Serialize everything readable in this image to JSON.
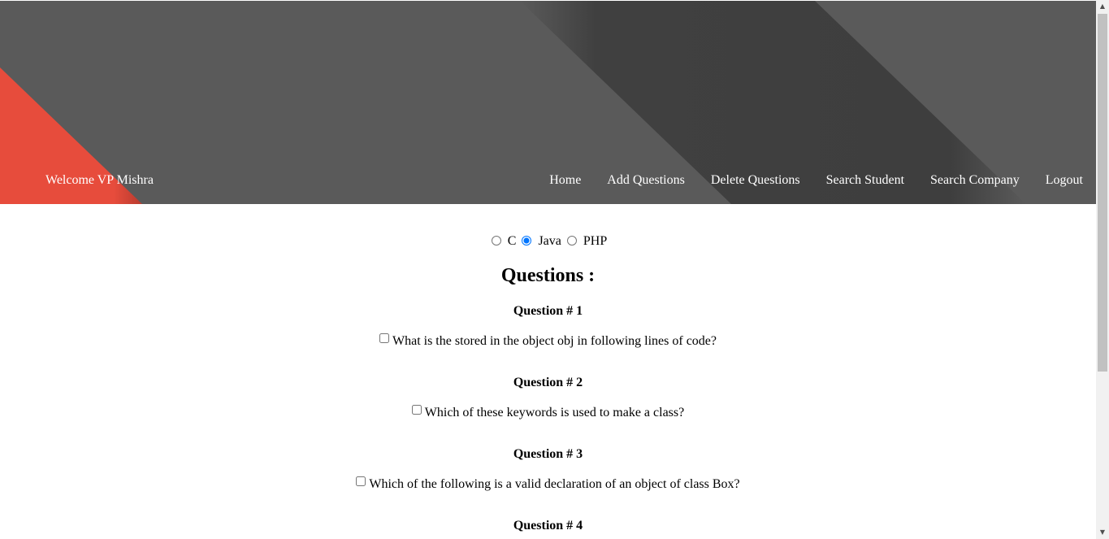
{
  "header": {
    "welcome": "Welcome VP Mishra",
    "nav": [
      "Home",
      "Add Questions",
      "Delete Questions",
      "Search Student",
      "Search Company",
      "Logout"
    ],
    "colors": {
      "banner": "#5a5a5a",
      "accent": "#e74c3c",
      "stripe": "#3f3f3f"
    }
  },
  "languages": {
    "options": [
      "C",
      "Java",
      "PHP"
    ],
    "selected": "Java"
  },
  "questions_title": "Questions :",
  "questions": [
    {
      "title": "Question # 1",
      "text": "What is the stored in the object obj in following lines of code?"
    },
    {
      "title": "Question # 2",
      "text": "Which of these keywords is used to make a class?"
    },
    {
      "title": "Question # 3",
      "text": "Which of the following is a valid declaration of an object of class Box?"
    },
    {
      "title": "Question # 4",
      "text": ""
    }
  ],
  "scrollbar": {
    "up_icon": "triangle-up",
    "down_icon": "triangle-down"
  }
}
